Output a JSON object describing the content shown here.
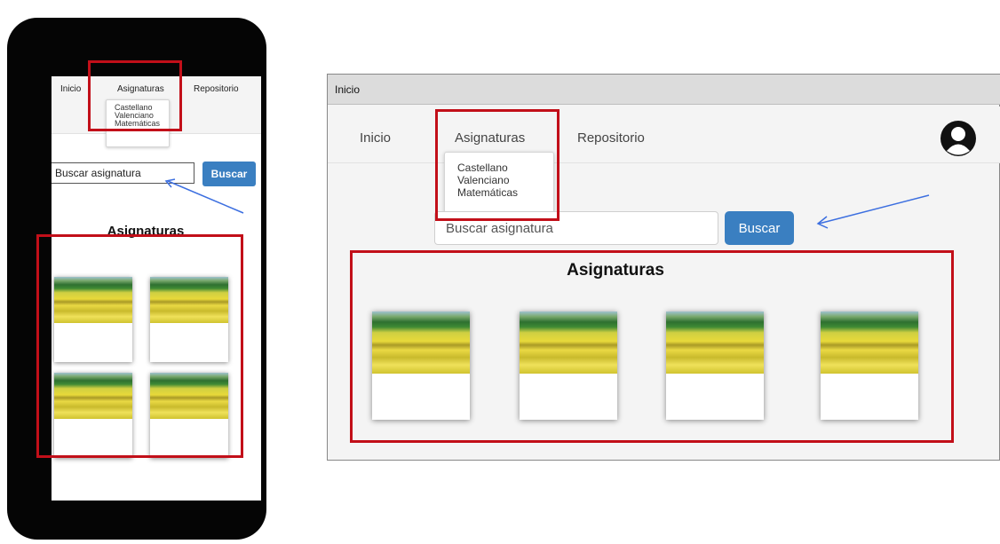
{
  "mobile": {
    "nav": {
      "items": [
        "Inicio",
        "Asignaturas",
        "Repositorio"
      ]
    },
    "dropdown": {
      "items": [
        "Castellano",
        "Valenciano",
        "Matemáticas"
      ]
    },
    "search": {
      "placeholder": "Buscar asignatura",
      "button_label": "Buscar"
    },
    "section_title": "Asignaturas",
    "card_count": 4
  },
  "desktop": {
    "window_title": "Inicio",
    "nav": {
      "items": [
        "Inicio",
        "Asignaturas",
        "Repositorio"
      ]
    },
    "avatar_icon": "user-avatar-icon",
    "dropdown": {
      "items": [
        "Castellano",
        "Valenciano",
        "Matemáticas"
      ]
    },
    "search": {
      "placeholder": "Buscar asignatura",
      "button_label": "Buscar"
    },
    "section_title": "Asignaturas",
    "card_count": 4
  },
  "colors": {
    "primary_button": "#3a7fc1",
    "annotation_box": "#c20f19",
    "annotation_arrow": "#3c6fe0",
    "nav_background": "#f4f4f4"
  }
}
